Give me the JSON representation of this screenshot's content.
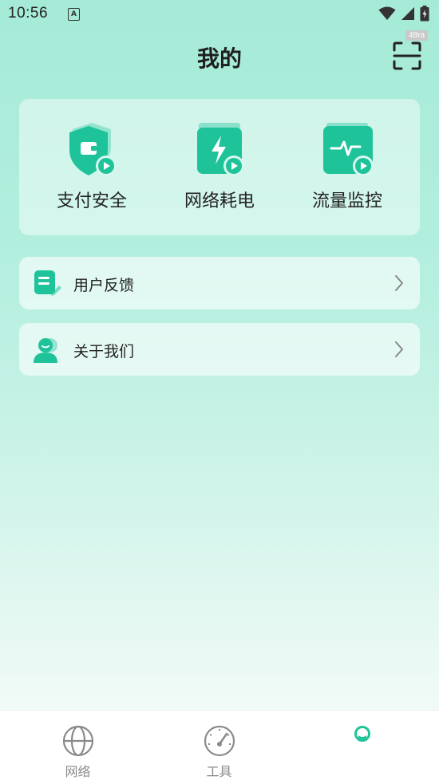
{
  "status_bar": {
    "time": "10:56",
    "notification_icon_letter": "A"
  },
  "header": {
    "title": "我的",
    "badge": "48ra"
  },
  "features": [
    {
      "label": "支付安全",
      "icon": "wallet-shield-icon"
    },
    {
      "label": "网络耗电",
      "icon": "battery-bolt-icon"
    },
    {
      "label": "流量监控",
      "icon": "pulse-monitor-icon"
    }
  ],
  "menu": [
    {
      "label": "用户反馈",
      "icon": "feedback-document-icon"
    },
    {
      "label": "关于我们",
      "icon": "person-icon"
    }
  ],
  "bottom_nav": [
    {
      "label": "网络",
      "icon": "globe-icon",
      "active": false
    },
    {
      "label": "工具",
      "icon": "speedometer-icon",
      "active": false
    },
    {
      "label": "",
      "icon": "profile-face-icon",
      "active": true
    }
  ],
  "colors": {
    "accent": "#1fc39a",
    "accent_dark": "#16a884",
    "background_top": "#a5ead7",
    "nav_inactive": "#8a8a8a"
  }
}
